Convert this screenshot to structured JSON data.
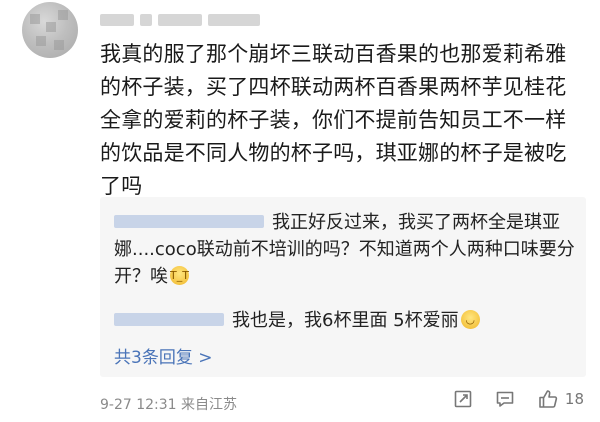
{
  "comment": {
    "text": "我真的服了那个崩坏三联动百香果的也那爱莉希雅的杯子装，买了四杯联动两杯百香果两杯芋见桂花全拿的爱莉的杯子装，你们不提前告知员工不一样的饮品是不同人物的杯子吗，琪亚娜的杯子是被吃了吗"
  },
  "replies": [
    {
      "text": "我正好反过来，我买了两杯全是琪亚娜....coco联动前不培训的吗？不知道两个人两种口味要分开？唉",
      "emoji": "crying-face"
    },
    {
      "text": "我也是，我6杯里面 5杯爱丽",
      "emoji": "smiling-face"
    }
  ],
  "more_replies_label": "共3条回复 >",
  "meta": {
    "timestamp": "9-27 12:31",
    "source": "来自江苏"
  },
  "actions": {
    "like_count": "18"
  },
  "colors": {
    "link": "#4a74b8",
    "reply_bg": "#f6f6f6",
    "meta": "#8a8a8a"
  }
}
